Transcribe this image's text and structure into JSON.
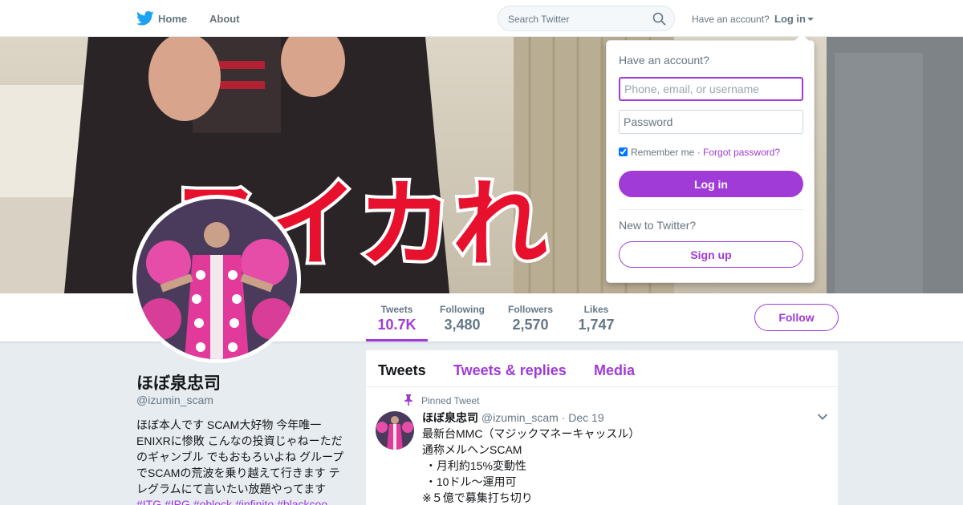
{
  "nav": {
    "home_label": "Home",
    "about_label": "About",
    "search_placeholder": "Search Twitter",
    "have_account": "Have an account?",
    "login_label": "Log in"
  },
  "banner": {
    "overlay_text": "ヌイカれ"
  },
  "profile": {
    "name": "ほぼ泉忠司",
    "handle": "@izumin_scam",
    "bio_lines": [
      "ほぼ本人です SCAM大好物 今年唯一",
      "ENIXRに惨敗 こんなの投資じゃねーただ",
      "のギャンブル でもおもろいよね グループ",
      "でSCAMの荒波を乗り越えて行きます テ",
      "レグラムにて言いたい放題やってます"
    ],
    "hashtags": "#ITG #IPG #oblock #infinito #blackcoo"
  },
  "stats": [
    {
      "label": "Tweets",
      "value": "10.7K",
      "active": true
    },
    {
      "label": "Following",
      "value": "3,480",
      "active": false
    },
    {
      "label": "Followers",
      "value": "2,570",
      "active": false
    },
    {
      "label": "Likes",
      "value": "1,747",
      "active": false
    }
  ],
  "follow_label": "Follow",
  "timeline": {
    "tabs": [
      "Tweets",
      "Tweets & replies",
      "Media"
    ],
    "active_tab": "Tweets"
  },
  "pinned_tweet": {
    "pinned_label": "Pinned Tweet",
    "name": "ほぼ泉忠司",
    "handle": "@izumin_scam",
    "dot": "·",
    "date": "Dec 19",
    "lines": [
      "最新台MMC（マジックマネーキャッスル）",
      "通称メルヘンSCAM",
      " ・月利約15%変動性",
      " ・10ドル〜運用可",
      "※５億で募集打ち切り"
    ]
  },
  "login_dropdown": {
    "title": "Have an account?",
    "username_placeholder": "Phone, email, or username",
    "password_placeholder": "Password",
    "remember_label": "Remember me",
    "separator": "·",
    "forgot_label": "Forgot password?",
    "login_button": "Log in",
    "new_prompt": "New to Twitter?",
    "signup_button": "Sign up"
  },
  "colors": {
    "accent": "#a03bd8",
    "twitter_blue": "#1da1f2",
    "background": "#e6ecf0"
  },
  "icons": [
    "twitter-bird-icon",
    "search-icon",
    "caret-down-icon",
    "pin-icon",
    "chevron-down-icon"
  ]
}
